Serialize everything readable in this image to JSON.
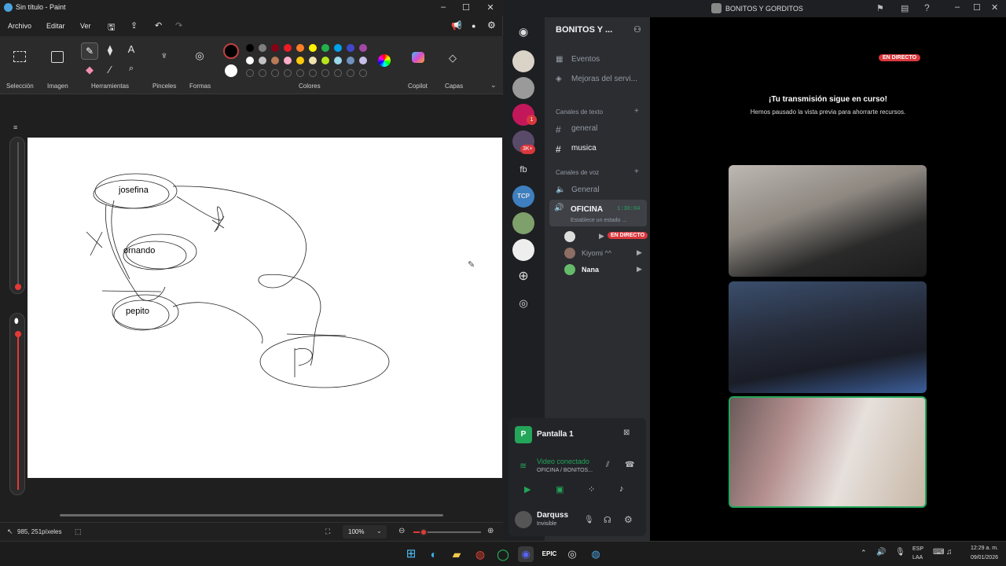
{
  "paint": {
    "title": "Sin título - Paint",
    "menu": [
      "Archivo",
      "Editar",
      "Ver"
    ],
    "ribbon_labels": {
      "selection": "Selección",
      "image": "Imagen",
      "tools": "Herramientas",
      "brushes": "Pinceles",
      "shapes": "Formas",
      "colors": "Colores",
      "copilot": "Copilot",
      "layers": "Capas"
    },
    "palette_row1": [
      "#000000",
      "#7f7f7f",
      "#880015",
      "#ed1c24",
      "#ff7f27",
      "#fff200",
      "#22b14c",
      "#00a2e8",
      "#3f48cc",
      "#a349a4"
    ],
    "palette_row2": [
      "#ffffff",
      "#c3c3c3",
      "#b97a57",
      "#ffaec9",
      "#ffc90e",
      "#efe4b0",
      "#b5e61d",
      "#99d9ea",
      "#7092be",
      "#c8bfe7"
    ],
    "canvas_words": [
      "josefina",
      "ornando",
      "pepito"
    ],
    "status": {
      "position": "985, 251píxeles",
      "zoom": "100%"
    }
  },
  "discord": {
    "window_title": "BONITOS Y GORDITOS",
    "server_name": "BONITOS Y ...",
    "events": "Eventos",
    "improve": "Mejoras del servi...",
    "text_channels_header": "Canales de texto",
    "text_channels": [
      "general",
      "musica"
    ],
    "voice_channels_header": "Canales de voz",
    "voice_general": "General",
    "voice_oficina": "OFICINA",
    "oficina_timer": "1:30:04",
    "oficina_status": "Establece un estado ...",
    "live_badge": "EN DIRECTO",
    "members": [
      "Kiyomi ^^",
      "Nana"
    ],
    "guild_badges": [
      "1",
      "3K+"
    ],
    "guild_fb": "fb",
    "guild_tcp": "TCP",
    "stage_live_badge": "EN DIRECTO",
    "stage_heading": "¡Tu transmisión sigue en curso!",
    "stage_sub": "Hemos pausado la vista previa para ahorrarte recursos.",
    "screen_panel": "Pantalla 1",
    "video_connected": "Video conectado",
    "video_location": "OFICINA / BONITOS...",
    "user_name": "Darquss",
    "user_status": "Invisible"
  },
  "taskbar": {
    "lang": "ESP",
    "lang2": "LAA",
    "time": "12:29 a. m.",
    "date": "09/01/2026"
  }
}
